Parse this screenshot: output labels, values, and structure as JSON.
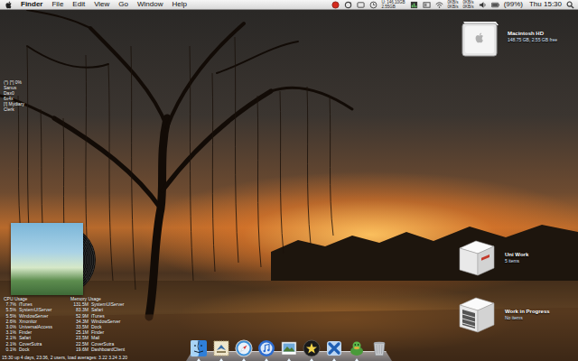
{
  "menu_bar": {
    "app": "Finder",
    "menus": [
      "File",
      "Edit",
      "View",
      "Go",
      "Window",
      "Help"
    ],
    "disk": [
      "U: 146.10GB",
      "2.55GB"
    ],
    "net_in": [
      "0KB/s",
      "0KB/s"
    ],
    "net_out": [
      "0KB/s",
      "0KB/s"
    ],
    "battery": "(99%)",
    "clock": "Thu 15:30"
  },
  "drive": {
    "label": "Macintosh HD",
    "detail": "148.75 GB, 2.55 GB free"
  },
  "folders": [
    {
      "label": "Uni Work",
      "detail": "5 items",
      "kind": "box"
    },
    {
      "label": "Work in Progress",
      "detail": "No items",
      "kind": "open"
    }
  ],
  "notes": {
    "lines": [
      "(*) [*] 0%",
      "Sanus",
      "Dax0",
      "6x4x",
      "[!] Mydiary",
      "Clerk"
    ]
  },
  "cpu": {
    "title": "CPU Usage",
    "rows": [
      {
        "value": "7.7%",
        "name": "iTunes"
      },
      {
        "value": "5.5%",
        "name": "SystemUIServer"
      },
      {
        "value": "5.5%",
        "name": "WindowServer"
      },
      {
        "value": "2.6%",
        "name": "Xmonitor"
      },
      {
        "value": "3.0%",
        "name": "UniversalAccess"
      },
      {
        "value": "3.1%",
        "name": "Finder"
      },
      {
        "value": "2.1%",
        "name": "Safari"
      },
      {
        "value": "2.1%",
        "name": "CoverSutra"
      },
      {
        "value": "0.1%",
        "name": "Dock"
      }
    ]
  },
  "memory": {
    "title": "Memory Usage",
    "rows": [
      {
        "value": "131.5M",
        "name": "SystemUIServer"
      },
      {
        "value": "83.3M",
        "name": "Safari"
      },
      {
        "value": "52.9M",
        "name": "iTunes"
      },
      {
        "value": "34.3M",
        "name": "WindowServer"
      },
      {
        "value": "33.5M",
        "name": "Dock"
      },
      {
        "value": "25.1M",
        "name": "Finder"
      },
      {
        "value": "23.5M",
        "name": "Mail"
      },
      {
        "value": "22.5M",
        "name": "CoverSutra"
      },
      {
        "value": "19.6M",
        "name": "DashboardClient"
      }
    ]
  },
  "uptime": "15:30  up 4 days, 23:36, 2 users, load averages: 3.22 3.24 3.20",
  "dock": {
    "items": [
      {
        "kind": "finder",
        "running": true
      },
      {
        "kind": "mail",
        "running": true
      },
      {
        "kind": "safari",
        "running": true
      },
      {
        "kind": "itunes",
        "running": true
      },
      {
        "kind": "photos",
        "running": true
      },
      {
        "kind": "frontrow",
        "running": true
      },
      {
        "kind": "xcode",
        "running": true
      },
      {
        "kind": "adium",
        "running": true
      },
      {
        "kind": "trash",
        "running": false
      }
    ]
  }
}
